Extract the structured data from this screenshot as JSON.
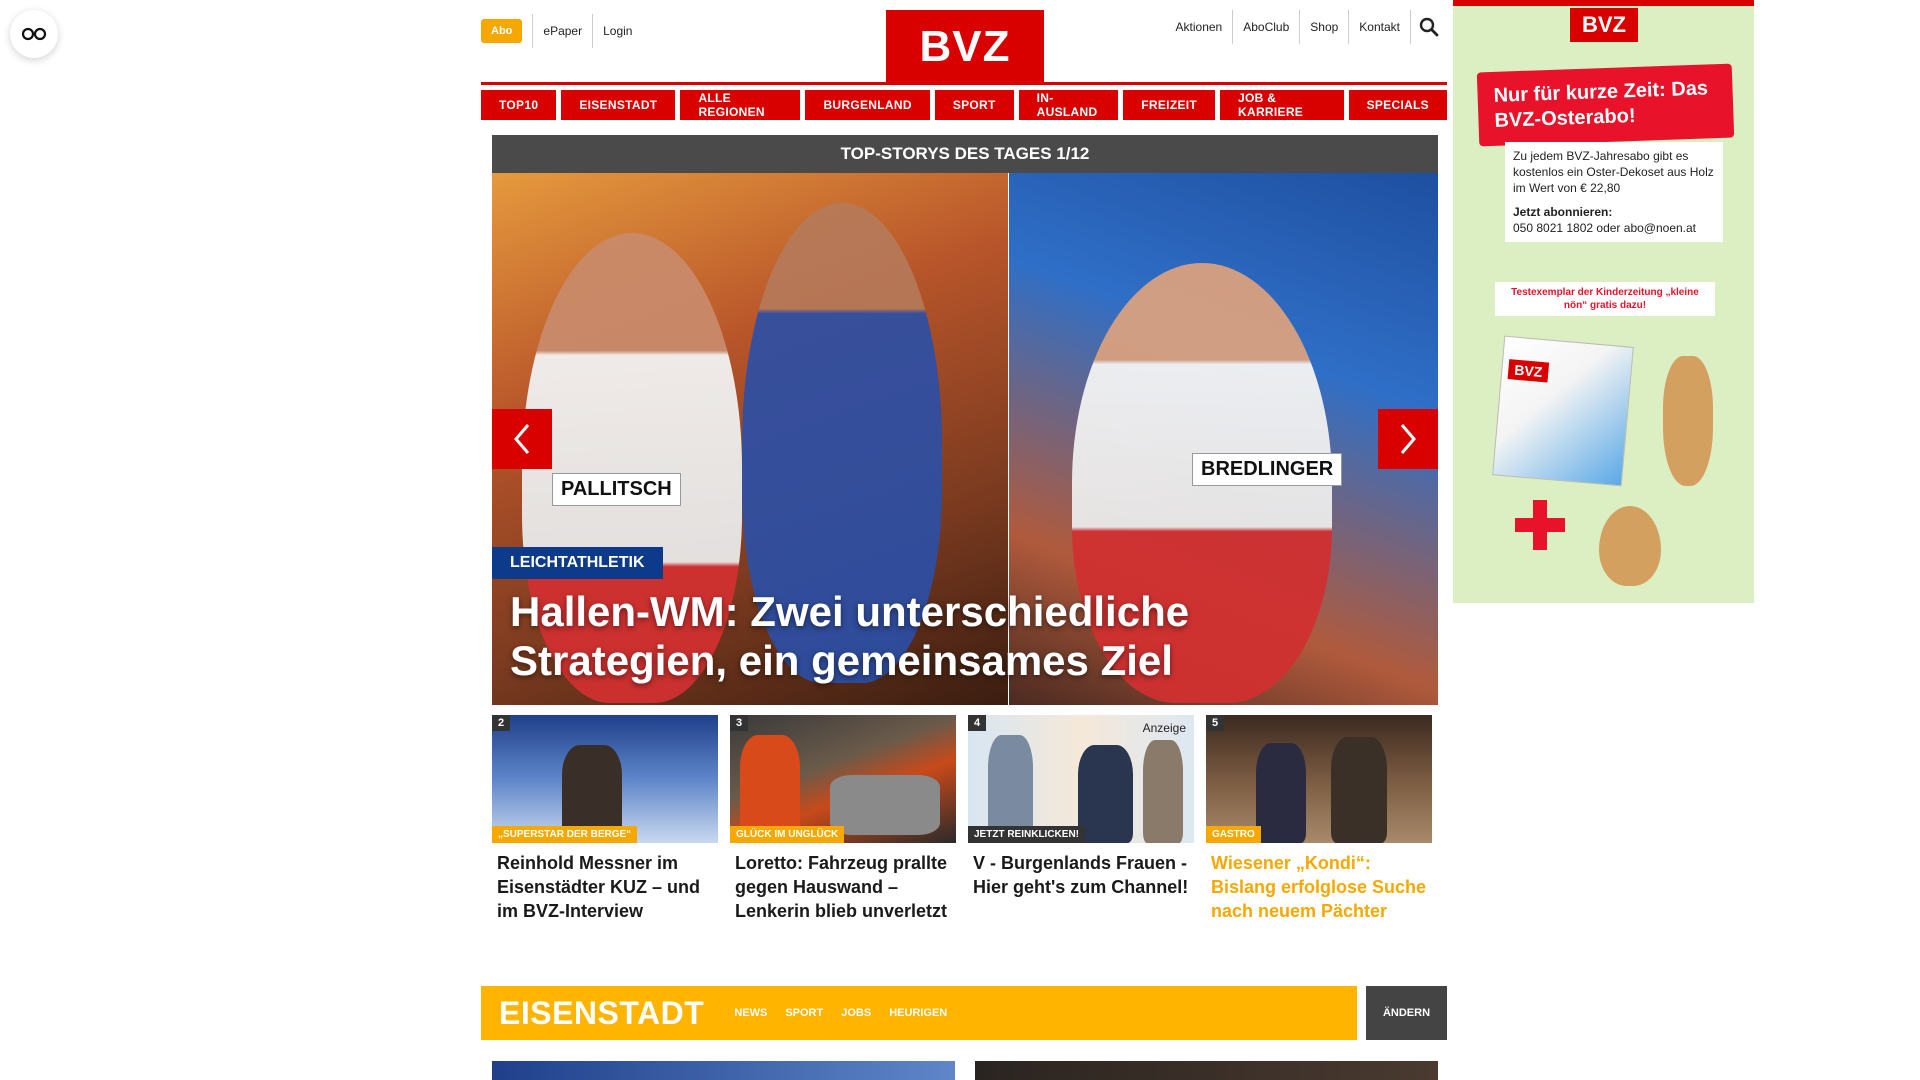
{
  "header": {
    "abo_label": "Abo",
    "epaper_label": "ePaper",
    "login_label": "Login",
    "logo_text": "BVZ",
    "right_links": [
      "Aktionen",
      "AboClub",
      "Shop",
      "Kontakt"
    ],
    "search_icon": "search-icon"
  },
  "nav": {
    "items": [
      "TOP10",
      "EISENSTADT",
      "ALLE REGIONEN",
      "BURGENLAND",
      "SPORT",
      "IN-AUSLAND",
      "FREIZEIT",
      "JOB & KARRIERE",
      "SPECIALS"
    ]
  },
  "top_stories": {
    "bar_title": "TOP-STORYS DES TAGES 1/12",
    "hero": {
      "category": "LEICHTATHLETIK",
      "title": "Hallen-WM: Zwei unterschiedliche Strategien, ein gemeinsames Ziel",
      "bib_left": "PALLITSCH",
      "bib_right": "BREDLINGER"
    },
    "teasers": [
      {
        "number": "2",
        "category": "„SUPERSTAR DER BERGE“",
        "title": "Reinhold Messner im Eisenstädter KUZ – und im BVZ-Interview",
        "ad_label": ""
      },
      {
        "number": "3",
        "category": "GLÜCK IM UNGLÜCK",
        "title": "Loretto: Fahrzeug prallte gegen Hauswand – Lenkerin blieb unverletzt",
        "ad_label": ""
      },
      {
        "number": "4",
        "category": "JETZT REINKLICKEN!",
        "title": "V - Burgenlands Frauen - Hier geht's zum Channel!",
        "ad_label": "Anzeige"
      },
      {
        "number": "5",
        "category": "GASTRO",
        "title": "Wiesener „Kondi“: Bislang erfolglose Suche nach neuem Pächter",
        "ad_label": ""
      }
    ]
  },
  "region": {
    "title": "EISENSTADT",
    "links": [
      "NEWS",
      "SPORT",
      "JOBS",
      "HEURIGEN"
    ],
    "change_label": "ÄNDERN"
  },
  "ad": {
    "logo": "BVZ",
    "headline": "Nur für kurze Zeit: Das BVZ-Osterabo!",
    "body": "Zu jedem BVZ-Jahresabo gibt es kostenlos ein Oster-Dekoset aus Holz im Wert von € 22,80",
    "cta_title": "Jetzt abonnieren:",
    "cta_body": "050 8021 1802 oder abo@noen.at",
    "test_line": "Testexemplar der Kinderzeitung „kleine nön“ gratis dazu!",
    "mag_logo": "BVZ"
  },
  "colors": {
    "brand_red": "#d90000",
    "accent_orange": "#f7a800",
    "region_yellow": "#ffb400",
    "category_blue": "#0d3a8a"
  }
}
